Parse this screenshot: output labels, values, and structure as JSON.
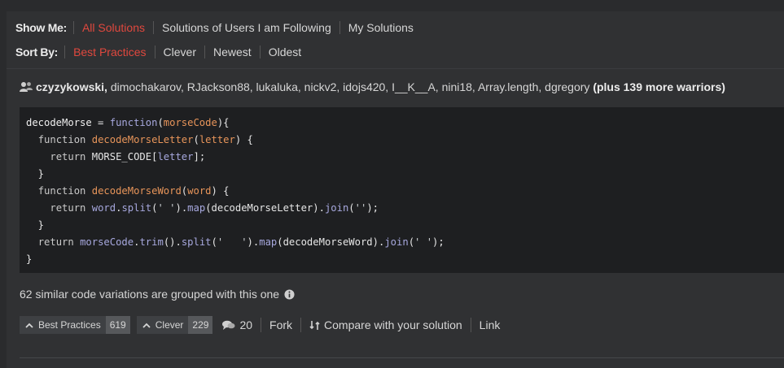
{
  "filters": {
    "show_label": "Show Me:",
    "show_options": [
      "All Solutions",
      "Solutions of Users I am Following",
      "My Solutions"
    ],
    "show_active": "All Solutions",
    "sort_label": "Sort By:",
    "sort_options": [
      "Best Practices",
      "Clever",
      "Newest",
      "Oldest"
    ],
    "sort_active": "Best Practices"
  },
  "solution": {
    "first_user": "czyzykowski,",
    "other_users": " dimochakarov, RJackson88, lukaluka, nickv2, idojs420, I__K__A, nini18, Array.length, dgregory ",
    "more_warriors": "(plus 139 more warriors)",
    "variations_text": "62 similar code variations are grouped with this one",
    "votes": {
      "best_practices_label": "Best Practices",
      "best_practices_count": "619",
      "clever_label": "Clever",
      "clever_count": "229"
    },
    "comments_count": "20",
    "fork_label": "Fork",
    "compare_label": "Compare with your solution",
    "link_label": "Link"
  },
  "colors": {
    "accent": "#e0483e",
    "background": "#303133",
    "code_background": "#1e1f21"
  },
  "icons": [
    "users-icon",
    "info-icon",
    "chevron-up-icon",
    "comment-icon",
    "compare-icon"
  ]
}
